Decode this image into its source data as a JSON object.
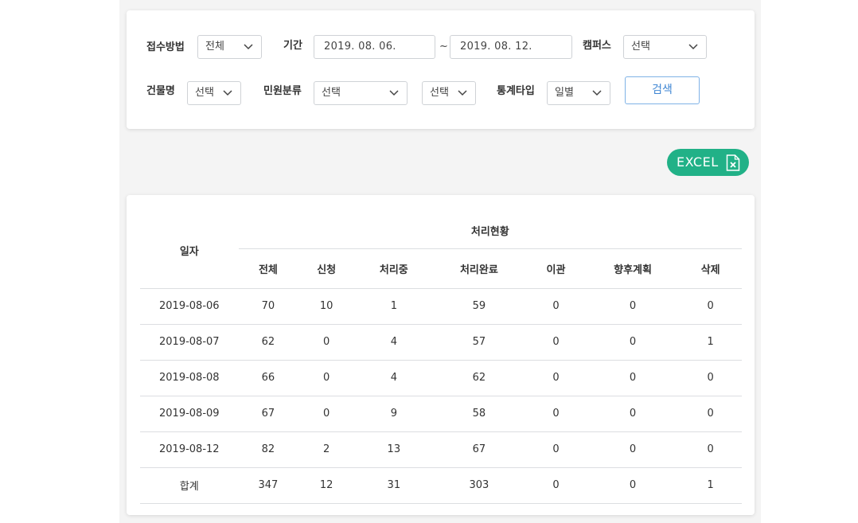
{
  "filters": {
    "intake_method": {
      "label": "접수방법",
      "value": "전체"
    },
    "period": {
      "label": "기간",
      "start": "2019. 08. 06.",
      "separator": "~",
      "end": "2019. 08. 12."
    },
    "campus": {
      "label": "캠퍼스",
      "value": "선택"
    },
    "building": {
      "label": "건물명",
      "value": "선택"
    },
    "complaint_category": {
      "label": "민원분류",
      "value": "선택",
      "sub_value": "선택"
    },
    "stat_type": {
      "label": "통계타입",
      "value": "일별"
    },
    "search_label": "검색"
  },
  "excel_label": "EXCEL",
  "table": {
    "date_header": "일자",
    "group_header": "처리현황",
    "columns": [
      "전체",
      "신청",
      "처리중",
      "처리완료",
      "이관",
      "향후계획",
      "삭제"
    ],
    "rows": [
      {
        "date": "2019-08-06",
        "values": [
          "70",
          "10",
          "1",
          "59",
          "0",
          "0",
          "0"
        ]
      },
      {
        "date": "2019-08-07",
        "values": [
          "62",
          "0",
          "4",
          "57",
          "0",
          "0",
          "1"
        ]
      },
      {
        "date": "2019-08-08",
        "values": [
          "66",
          "0",
          "4",
          "62",
          "0",
          "0",
          "0"
        ]
      },
      {
        "date": "2019-08-09",
        "values": [
          "67",
          "0",
          "9",
          "58",
          "0",
          "0",
          "0"
        ]
      },
      {
        "date": "2019-08-12",
        "values": [
          "82",
          "2",
          "13",
          "67",
          "0",
          "0",
          "0"
        ]
      }
    ],
    "total": {
      "date": "합계",
      "values": [
        "347",
        "12",
        "31",
        "303",
        "0",
        "0",
        "1"
      ]
    }
  },
  "colors": {
    "excel_green": "#21b187",
    "search_blue": "#3f86d3"
  }
}
